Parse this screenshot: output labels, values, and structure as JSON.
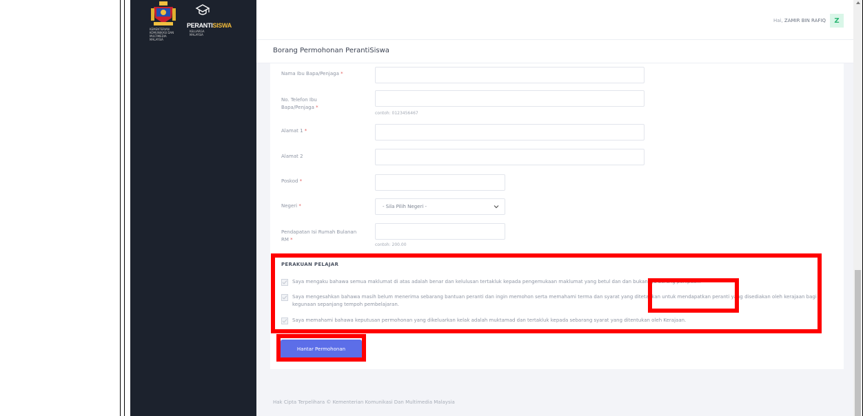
{
  "branding": {
    "crest_caption": "KEMENTERIAN KOMUNIKASI DAN MULTIMEDIA MALAYSIA",
    "brand_name_white": "PERANTI",
    "brand_name_accent": "SISWA",
    "brand_subtitle": "KELUARGA MALAYSIA"
  },
  "header": {
    "greeting": "Hai,",
    "user_name": "ZAMIR BIN RAFIQ",
    "avatar_letter": "Z"
  },
  "page": {
    "title": "Borang Permohonan PerantiSiswa"
  },
  "form": {
    "parent_name_label": "Nama Ibu Bapa/Penjaga",
    "parent_phone_label": "No. Telefon Ibu Bapa/Penjaga",
    "parent_phone_hint": "contoh: 0123456467",
    "address1_label": "Alamat 1",
    "address2_label": "Alamat 2",
    "postcode_label": "Poskod",
    "state_label": "Negeri",
    "state_selected": "- Sila Pilih Negeri -",
    "income_label": "Pendapatan Isi Rumah Bulanan RM",
    "income_hint": "contoh: 200.00",
    "required_mark": "*"
  },
  "declaration": {
    "title": "PERAKUAN PELAJAR",
    "items": [
      "Saya mengaku bahawa semua maklumat di atas adalah benar dan kelulusan tertakluk kepada pengemukaan maklumat yang betul dan dan bukannya borang penipuan.",
      "Saya mengesahkan bahawa masih belum menerima sebarang bantuan peranti dan ingin memohon serta memahami terma dan syarat yang ditetapkan untuk mendapatkan peranti yang disediakan oleh kerajaan bagi kegunaan sepanjang tempoh pembelajaran.",
      "Saya memahami bahawa keputusan permohonan yang dikeluarkan kelak adalah muktamad dan tertakluk kepada sebarang syarat yang ditentukan oleh Kerajaan."
    ]
  },
  "actions": {
    "submit_label": "Hantar Permohonan"
  },
  "footer": {
    "text": "Hak Cipta Terpelihara © Kementerian Komunikasi Dan Multimedia Malaysia"
  },
  "colors": {
    "sidebar_bg": "#1c222d",
    "accent_button": "#5c6ee8",
    "annotation_red": "#ff0000",
    "avatar_bg": "#d9f6e8",
    "avatar_fg": "#2bb673"
  }
}
